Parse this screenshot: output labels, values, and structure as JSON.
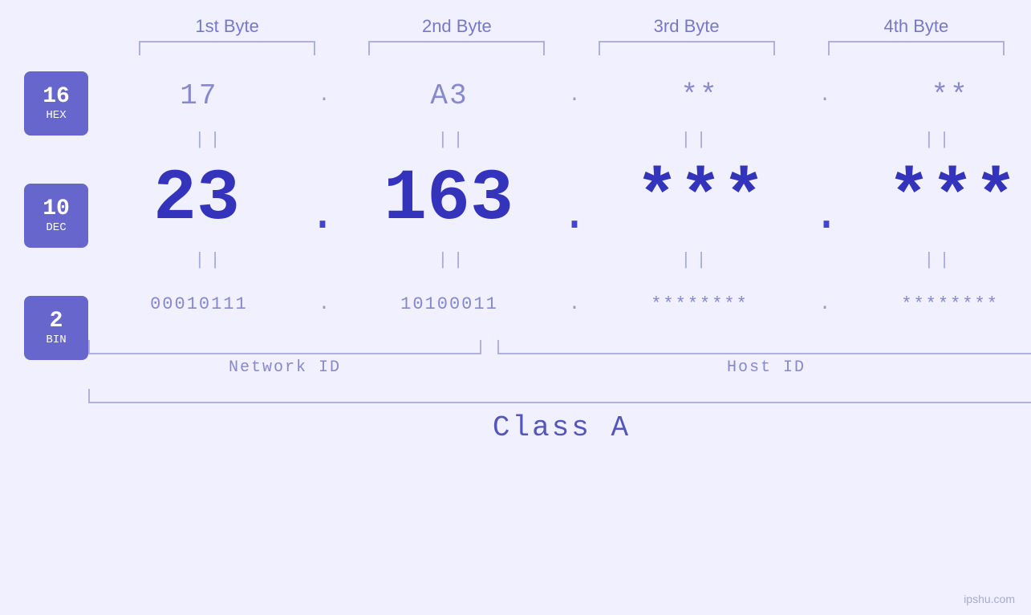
{
  "byteHeaders": {
    "b1": "1st Byte",
    "b2": "2nd Byte",
    "b3": "3rd Byte",
    "b4": "4th Byte"
  },
  "badges": {
    "hex": {
      "num": "16",
      "label": "HEX"
    },
    "dec": {
      "num": "10",
      "label": "DEC"
    },
    "bin": {
      "num": "2",
      "label": "BIN"
    }
  },
  "hexRow": {
    "b1": "17",
    "b2": "A3",
    "b3": "**",
    "b4": "**"
  },
  "decRow": {
    "b1": "23",
    "b2": "163",
    "b3": "***",
    "b4": "***"
  },
  "binRow": {
    "b1": "00010111",
    "b2": "10100011",
    "b3": "********",
    "b4": "********"
  },
  "labels": {
    "networkId": "Network ID",
    "hostId": "Host ID",
    "classA": "Class A"
  },
  "watermark": "ipshu.com"
}
